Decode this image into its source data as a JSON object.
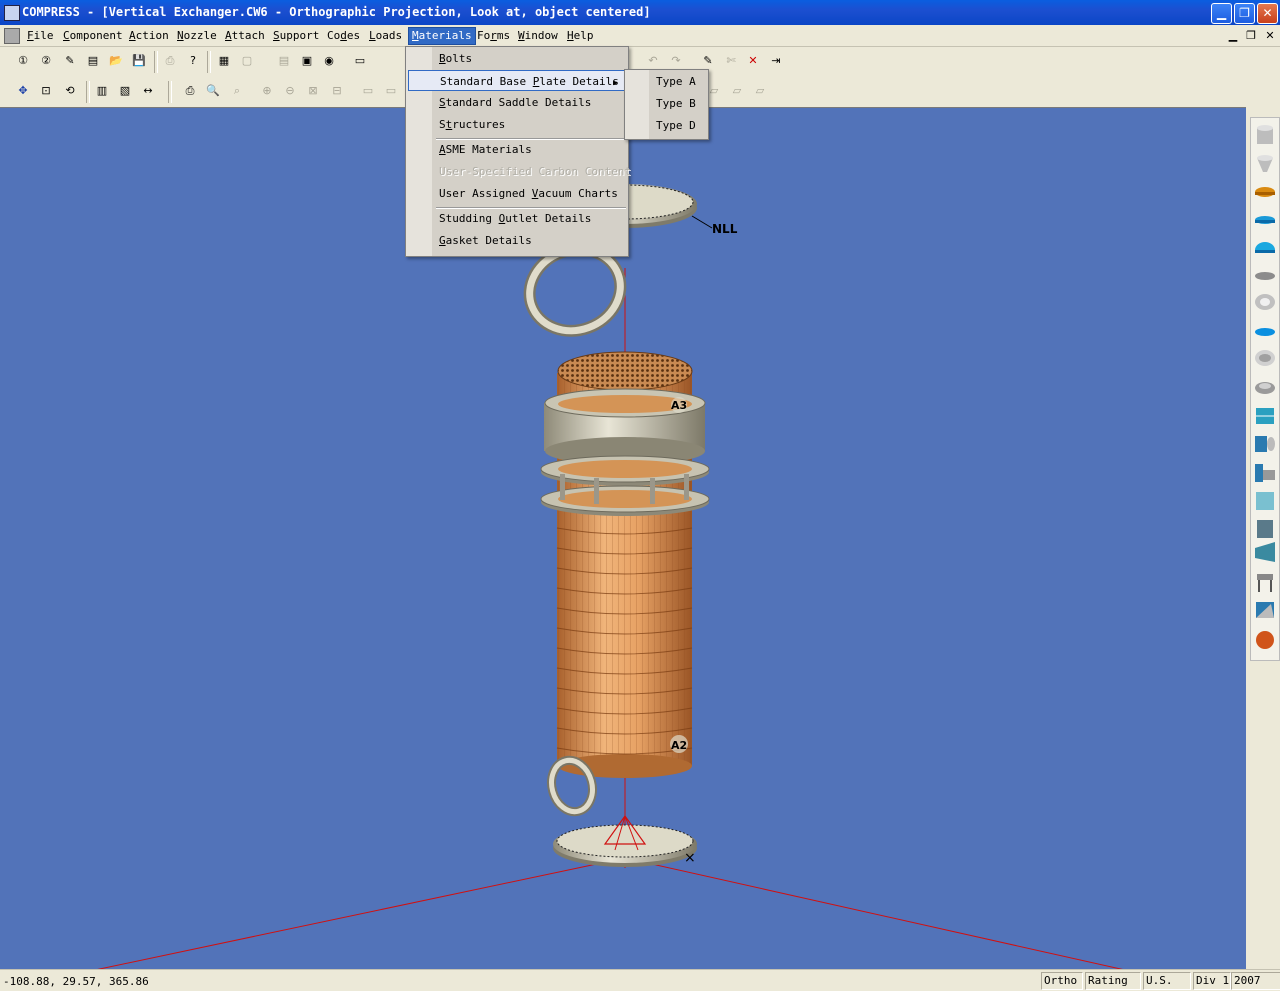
{
  "window": {
    "title": "COMPRESS - [Vertical Exchanger.CW6 - Orthographic Projection, Look at, object centered]"
  },
  "menubar": {
    "items": [
      {
        "label": "File",
        "ul": "F",
        "rest": "ile"
      },
      {
        "label": "Component",
        "ul": "C",
        "rest": "omponent"
      },
      {
        "label": "Action",
        "ul": "A",
        "rest": "ction"
      },
      {
        "label": "Nozzle",
        "ul": "N",
        "rest": "ozzle"
      },
      {
        "label": "Attach",
        "ul": "A",
        "rest": "ttach"
      },
      {
        "label": "Support",
        "ul": "S",
        "rest": "upport"
      },
      {
        "label": "Codes",
        "pre": "Co",
        "ul": "d",
        "rest": "es"
      },
      {
        "label": "Loads",
        "ul": "L",
        "rest": "oads"
      },
      {
        "label": "Materials",
        "ul": "M",
        "rest": "aterials"
      },
      {
        "label": "Forms",
        "pre": "Fo",
        "ul": "r",
        "rest": "ms"
      },
      {
        "label": "Window",
        "ul": "W",
        "rest": "indow"
      },
      {
        "label": "Help",
        "ul": "H",
        "rest": "elp"
      }
    ],
    "active": "Materials"
  },
  "materials_menu": {
    "items": [
      {
        "label": "Bolts",
        "ul": "B",
        "rest": "olts"
      },
      {
        "label": "Standard Base Plate Details",
        "pre": "Standard Base ",
        "ul": "P",
        "rest": "late Details",
        "submenu": true,
        "highlighted": true
      },
      {
        "label": "Standard Saddle Details",
        "ul": "S",
        "rest": "tandard Saddle Details"
      },
      {
        "label": "Structures",
        "pre": "S",
        "ul": "t",
        "rest": "ructures"
      },
      {
        "label": "ASME Materials",
        "ul": "A",
        "rest": "SME Materials"
      },
      {
        "label": "User-Specified Carbon Content",
        "disabled": true
      },
      {
        "label": "User Assigned Vacuum Charts",
        "pre": "User Assigned ",
        "ul": "V",
        "rest": "acuum Charts"
      },
      {
        "label": "Studding Outlet Details",
        "pre": "Studding ",
        "ul": "O",
        "rest": "utlet Details"
      },
      {
        "label": "Gasket Details",
        "ul": "G",
        "rest": "asket Details"
      }
    ],
    "submenu_items": [
      "Type A",
      "Type B",
      "Type D"
    ]
  },
  "viewport": {
    "background": "#5273b9",
    "labels": {
      "nll": "NLL",
      "a3": "A3",
      "a2": "A2"
    }
  },
  "statusbar": {
    "coords": "-108.88, 29.57, 365.86",
    "panels": [
      "Ortho",
      "Rating",
      "U.S.",
      "Div 1",
      "2007"
    ]
  },
  "colors": {
    "titlebar": "#0b46c6",
    "menu_highlight": "#316ac5",
    "shell": "#d99a5a"
  }
}
